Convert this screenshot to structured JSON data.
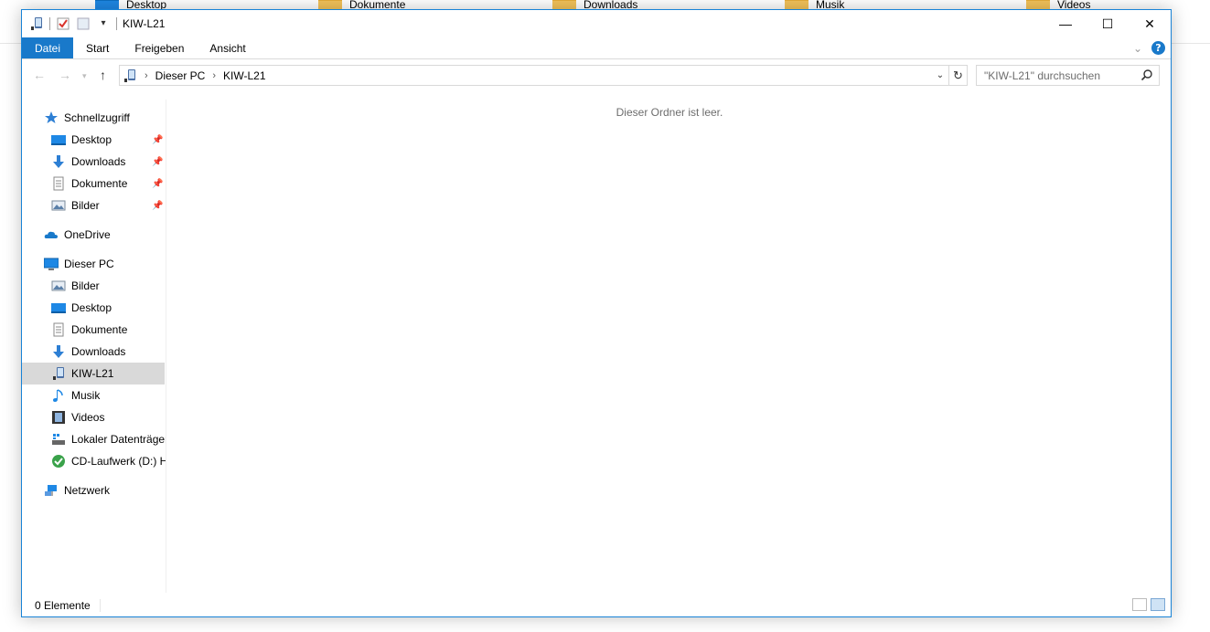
{
  "background_items": [
    {
      "label": "Desktop",
      "icon": "desktop-icon"
    },
    {
      "label": "Dokumente",
      "icon": "documents-icon"
    },
    {
      "label": "Downloads",
      "icon": "downloads-icon"
    },
    {
      "label": "Musik",
      "icon": "music-icon"
    },
    {
      "label": "Videos",
      "icon": "videos-icon"
    }
  ],
  "window": {
    "title": "KIW-L21",
    "controls": {
      "minimize": "—",
      "maximize": "☐",
      "close": "✕"
    }
  },
  "ribbon": {
    "tabs": [
      "Datei",
      "Start",
      "Freigeben",
      "Ansicht"
    ],
    "help": "?"
  },
  "address": {
    "breadcrumb": [
      "Dieser PC",
      "KIW-L21"
    ]
  },
  "search": {
    "placeholder": "\"KIW-L21\" durchsuchen"
  },
  "sidebar": {
    "quick_access": "Schnellzugriff",
    "quick_items": [
      "Desktop",
      "Downloads",
      "Dokumente",
      "Bilder"
    ],
    "onedrive": "OneDrive",
    "this_pc": "Dieser PC",
    "pc_items": [
      "Bilder",
      "Desktop",
      "Dokumente",
      "Downloads",
      "KIW-L21",
      "Musik",
      "Videos",
      "Lokaler Datenträger",
      "CD-Laufwerk (D:) H"
    ],
    "network": "Netzwerk"
  },
  "content": {
    "empty_message": "Dieser Ordner ist leer."
  },
  "status": {
    "count": "0 Elemente"
  },
  "colors": {
    "accent": "#1979ca",
    "window_border": "#1883d7",
    "selected_bg": "#d9d9d9"
  }
}
